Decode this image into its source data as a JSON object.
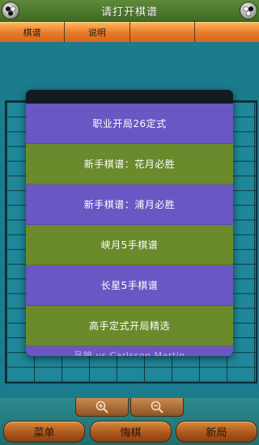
{
  "header": {
    "title": "请打开棋谱",
    "left_icon": "go-stones-icon",
    "right_icon": "go-stones-icon"
  },
  "tabs": [
    {
      "label": "棋谱"
    },
    {
      "label": "说明"
    },
    {
      "label": ""
    },
    {
      "label": ""
    }
  ],
  "list": {
    "items": [
      {
        "label": "职业开局26定式",
        "color": "#6a57c3"
      },
      {
        "label": "新手棋谱：花月必胜",
        "color": "#6a8a2c"
      },
      {
        "label": "新手棋谱：浦月必胜",
        "color": "#6a57c3"
      },
      {
        "label": "峡月5手棋谱",
        "color": "#6a8a2c"
      },
      {
        "label": "长星5手棋谱",
        "color": "#6a57c3"
      },
      {
        "label": "高手定式开局精选",
        "color": "#6a8a2c"
      }
    ],
    "partial_item": "吴镝 vs Carlsson Martin"
  },
  "zoom": {
    "zoom_in_icon": "zoom-in-icon",
    "zoom_out_icon": "zoom-out-icon"
  },
  "actions": {
    "menu_label": "菜单",
    "undo_label": "悔棋",
    "new_label": "新局"
  },
  "colors": {
    "title_bar": "#4f7a2e",
    "tab_orange": "#e6782a",
    "board_teal": "#1f8799",
    "list_purple": "#6a57c3",
    "list_green": "#6a8a2c",
    "button_brown": "#a9551a"
  }
}
